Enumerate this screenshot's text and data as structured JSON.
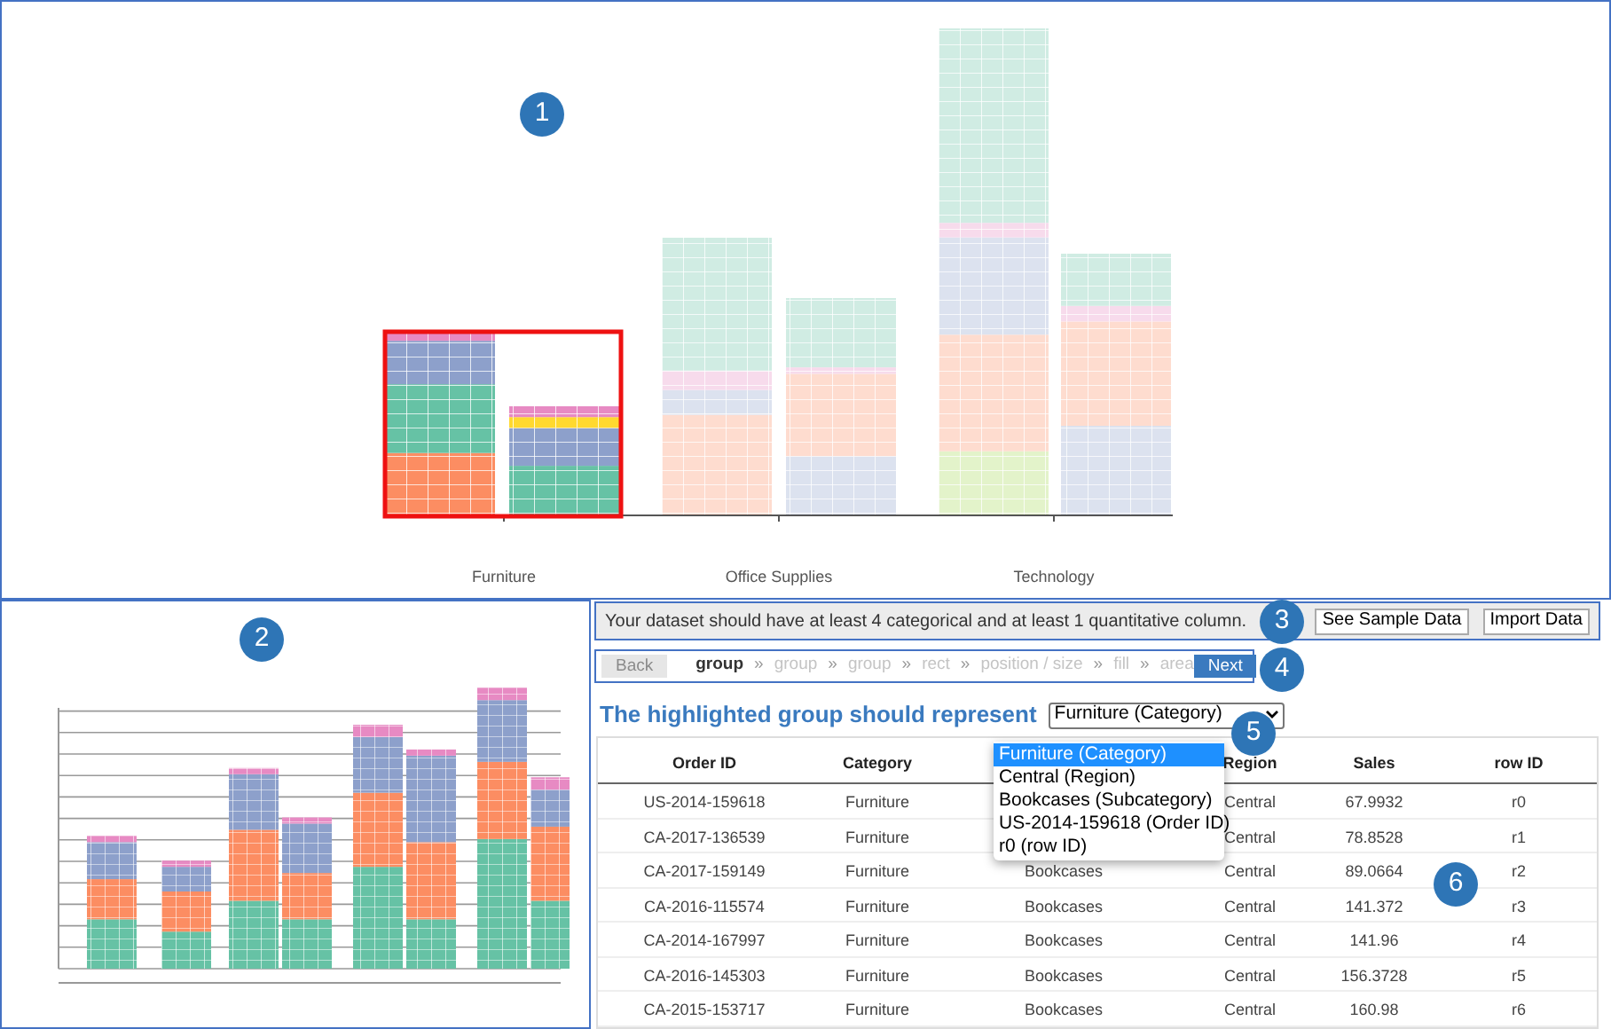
{
  "main_chart": {
    "categories": [
      {
        "label": "Furniture",
        "highlighted": true
      },
      {
        "label": "Office Supplies",
        "highlighted": false
      },
      {
        "label": "Technology",
        "highlighted": false
      }
    ]
  },
  "info_bar": {
    "message": "Your dataset should have at least 4 categorical and at least 1 quantitative column.",
    "buttons": [
      "See Sample Data",
      "Import Data"
    ]
  },
  "steps": {
    "back": {
      "label": "Back",
      "disabled": true
    },
    "separator": "»",
    "items": [
      {
        "label": "group",
        "selected": true
      },
      {
        "label": "group",
        "selected": false
      },
      {
        "label": "group",
        "selected": false
      },
      {
        "label": "rect",
        "selected": false
      },
      {
        "label": "position / size",
        "selected": false
      },
      {
        "label": "fill",
        "selected": false
      },
      {
        "label": "area",
        "selected": false
      }
    ],
    "next": "Next"
  },
  "prompt": {
    "label": "The highlighted group should represent",
    "select_value": "Furniture (Category)",
    "options": [
      {
        "label": "Furniture (Category)",
        "selected": true
      },
      {
        "label": "Central (Region)",
        "selected": false
      },
      {
        "label": "Bookcases (Subcategory)",
        "selected": false
      },
      {
        "label": "US-2014-159618 (Order ID)",
        "selected": false
      },
      {
        "label": "r0 (row ID)",
        "selected": false
      }
    ]
  },
  "table": {
    "columns": [
      "Order ID",
      "Category",
      null,
      "Region",
      "Sales",
      "row ID"
    ],
    "rows": [
      [
        "US-2014-159618",
        "Furniture",
        null,
        "Central",
        "67.9932",
        "r0"
      ],
      [
        "CA-2017-136539",
        "Furniture",
        null,
        "Central",
        "78.8528",
        "r1"
      ],
      [
        "CA-2017-159149",
        "Furniture",
        "Bookcases",
        "Central",
        "89.0664",
        "r2"
      ],
      [
        "CA-2016-115574",
        "Furniture",
        "Bookcases",
        "Central",
        "141.372",
        "r3"
      ],
      [
        "CA-2014-167997",
        "Furniture",
        "Bookcases",
        "Central",
        "141.96",
        "r4"
      ],
      [
        "CA-2016-145303",
        "Furniture",
        "Bookcases",
        "Central",
        "156.3728",
        "r5"
      ],
      [
        "CA-2015-153717",
        "Furniture",
        "Bookcases",
        "Central",
        "160.98",
        "r6"
      ]
    ]
  },
  "callouts": [
    "1",
    "2",
    "3",
    "4",
    "5",
    "6"
  ]
}
